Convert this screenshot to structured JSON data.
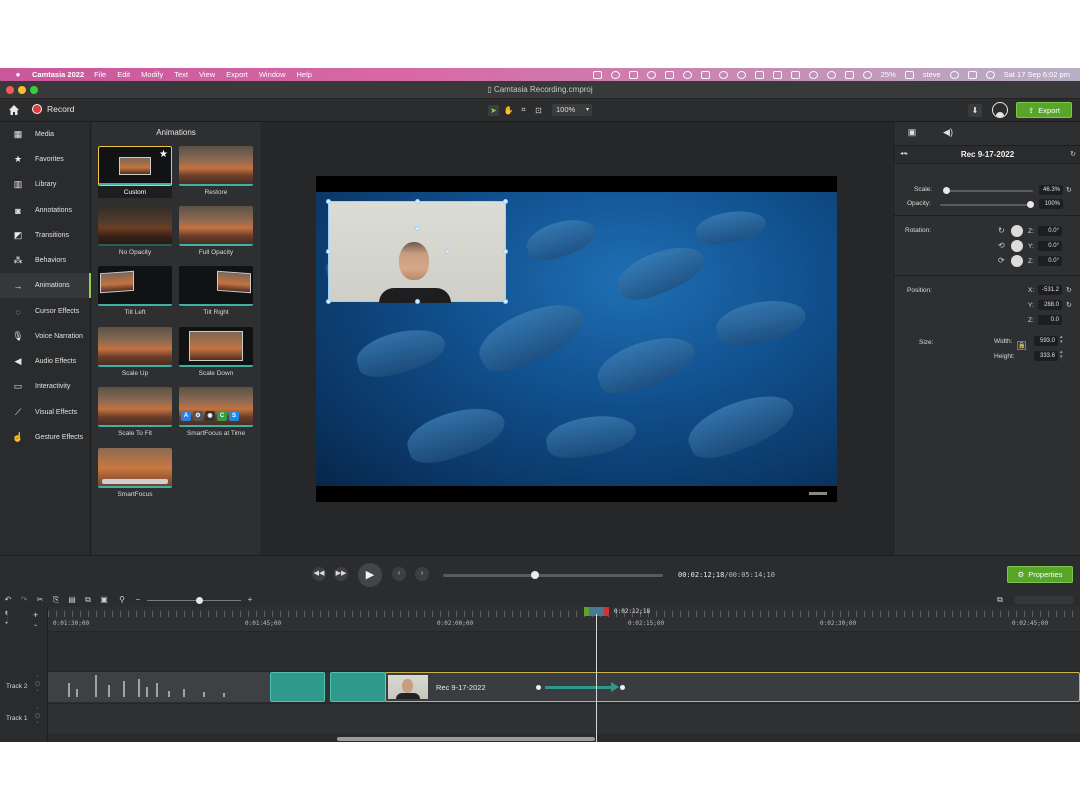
{
  "menubar": {
    "app_name": "Camtasia 2022",
    "menus": [
      "File",
      "Edit",
      "Modify",
      "Text",
      "View",
      "Export",
      "Window",
      "Help"
    ],
    "battery": "25%",
    "user": "steve",
    "datetime": "Sat 17 Sep  6:02 pm"
  },
  "window": {
    "title": "Camtasia Recording.cmproj"
  },
  "toolbar": {
    "record_label": "Record",
    "zoom": "100%",
    "export_label": "Export"
  },
  "sidebar": {
    "items": [
      {
        "label": "Media",
        "icon": "film-icon"
      },
      {
        "label": "Favorites",
        "icon": "star-icon"
      },
      {
        "label": "Library",
        "icon": "library-icon"
      },
      {
        "label": "Annotations",
        "icon": "annotation-icon"
      },
      {
        "label": "Transitions",
        "icon": "transition-icon"
      },
      {
        "label": "Behaviors",
        "icon": "behavior-icon"
      },
      {
        "label": "Animations",
        "icon": "animation-arrow-icon"
      },
      {
        "label": "Cursor Effects",
        "icon": "cursor-icon"
      },
      {
        "label": "Voice Narration",
        "icon": "microphone-icon"
      },
      {
        "label": "Audio Effects",
        "icon": "speaker-icon"
      },
      {
        "label": "Interactivity",
        "icon": "interactivity-icon"
      },
      {
        "label": "Visual Effects",
        "icon": "wand-icon"
      },
      {
        "label": "Gesture Effects",
        "icon": "hand-icon"
      }
    ],
    "active": "Animations"
  },
  "animations": {
    "title": "Animations",
    "tiles": [
      "Custom",
      "Restore",
      "No Opacity",
      "Full Opacity",
      "Tilt Left",
      "Tilt Right",
      "Scale Up",
      "Scale Down",
      "Scale To Fit",
      "SmartFocus at Time",
      "SmartFocus"
    ],
    "selected": "Custom"
  },
  "properties": {
    "clip_name": "Rec 9-17-2022",
    "scale_label": "Scale:",
    "scale_value": "46.3%",
    "scale_level": 0.463,
    "opacity_label": "Opacity:",
    "opacity_value": "100%",
    "opacity_level": 1.0,
    "rotation_label": "Rotation:",
    "rotation": {
      "z": "0.0°",
      "y": "0.0°",
      "x": "0.0°"
    },
    "position_label": "Position:",
    "position": {
      "x": "-531.2",
      "y": "288.0",
      "z": "0.0"
    },
    "size_label": "Size:",
    "width_label": "Width:",
    "height_label": "Height:",
    "width": "593.0",
    "height": "333.6",
    "axis": {
      "x": "X:",
      "y": "Y:",
      "z": "Z:"
    }
  },
  "playback": {
    "time_current": "00:02:12;18",
    "time_total": "00:05:14;10",
    "progress": 0.42,
    "properties_label": "Properties"
  },
  "timeline": {
    "ruler_ticks": [
      "0:01:30;00",
      "0:01:45;00",
      "0:02:00;00",
      "0:02:15;00",
      "0:02:30;00",
      "0:02:45;00"
    ],
    "playhead_time": "0:02:12;18",
    "tracks": [
      {
        "label": "Track 2",
        "clip": "Rec 9-17-2022"
      },
      {
        "label": "Track 1"
      }
    ]
  }
}
